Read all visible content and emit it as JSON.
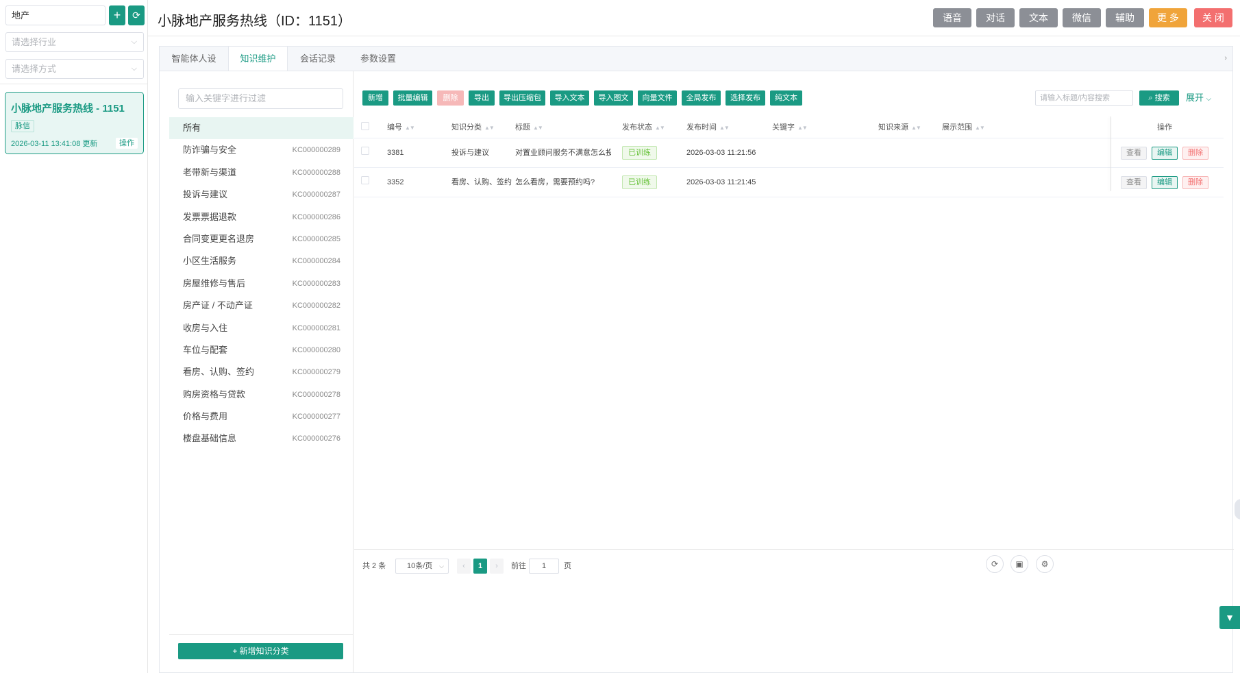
{
  "sidebar": {
    "search_value": "地产",
    "add_icon": "plus-icon",
    "refresh_icon": "refresh-icon",
    "industry_placeholder": "请选择行业",
    "method_placeholder": "请选择方式",
    "agent": {
      "name": "小脉地产服务热线 - 1151",
      "tag": "脉信",
      "updated": "2026-03-11 13:41:08 更新",
      "op": "操作"
    }
  },
  "header": {
    "title": "小脉地产服务热线（ID：1151）",
    "buttons": [
      "语音",
      "对话",
      "文本",
      "微信",
      "辅助",
      "更 多",
      "关 闭"
    ],
    "colors": {
      "gray": "#8c8f96",
      "more": "#f0a43a",
      "close": "#f36f6f"
    }
  },
  "tabs": [
    "智能体人设",
    "知识维护",
    "会话记录",
    "参数设置"
  ],
  "active_tab": "知识维护",
  "categories": {
    "filter_placeholder": "输入关键字进行过滤",
    "all_label": "所有",
    "items": [
      {
        "name": "防诈骗与安全",
        "code": "KC000000289"
      },
      {
        "name": "老带新与渠道",
        "code": "KC000000288"
      },
      {
        "name": "投诉与建议",
        "code": "KC000000287"
      },
      {
        "name": "发票票据退款",
        "code": "KC000000286"
      },
      {
        "name": "合同变更更名退房",
        "code": "KC000000285"
      },
      {
        "name": "小区生活服务",
        "code": "KC000000284"
      },
      {
        "name": "房屋维修与售后",
        "code": "KC000000283"
      },
      {
        "name": "房产证 / 不动产证",
        "code": "KC000000282"
      },
      {
        "name": "收房与入住",
        "code": "KC000000281"
      },
      {
        "name": "车位与配套",
        "code": "KC000000280"
      },
      {
        "name": "看房、认购、签约",
        "code": "KC000000279"
      },
      {
        "name": "购房资格与贷款",
        "code": "KC000000278"
      },
      {
        "name": "价格与费用",
        "code": "KC000000277"
      },
      {
        "name": "楼盘基础信息",
        "code": "KC000000276"
      }
    ],
    "add_button": "+ 新增知识分类"
  },
  "toolbar": {
    "buttons": [
      "新增",
      "批量编辑",
      "删除",
      "导出",
      "导出压缩包",
      "导入文本",
      "导入图文",
      "向量文件",
      "全局发布",
      "选择发布",
      "纯文本"
    ],
    "search_placeholder": "请输入标题/内容搜索",
    "search_button": "搜索",
    "expand": "展开"
  },
  "table": {
    "columns": [
      "编号",
      "知识分类",
      "标题",
      "发布状态",
      "发布时间",
      "关键字",
      "知识来源",
      "展示范围",
      "操作"
    ],
    "rows": [
      {
        "id": "3381",
        "category": "投诉与建议",
        "title": "对置业顾问服务不满意怎么投...",
        "status": "已训练",
        "time": "2026-03-03 11:21:56"
      },
      {
        "id": "3352",
        "category": "看房、认购、签约",
        "title": "怎么看房，需要预约吗?",
        "status": "已训练",
        "time": "2026-03-03 11:21:45"
      }
    ],
    "ops": [
      "查看",
      "编辑",
      "删除"
    ]
  },
  "pager": {
    "total": "共 2 条",
    "size": "10条/页",
    "current": "1",
    "goto": "前往",
    "goto_value": "1",
    "page_suffix": "页"
  },
  "accent_color": "#1a9a83"
}
